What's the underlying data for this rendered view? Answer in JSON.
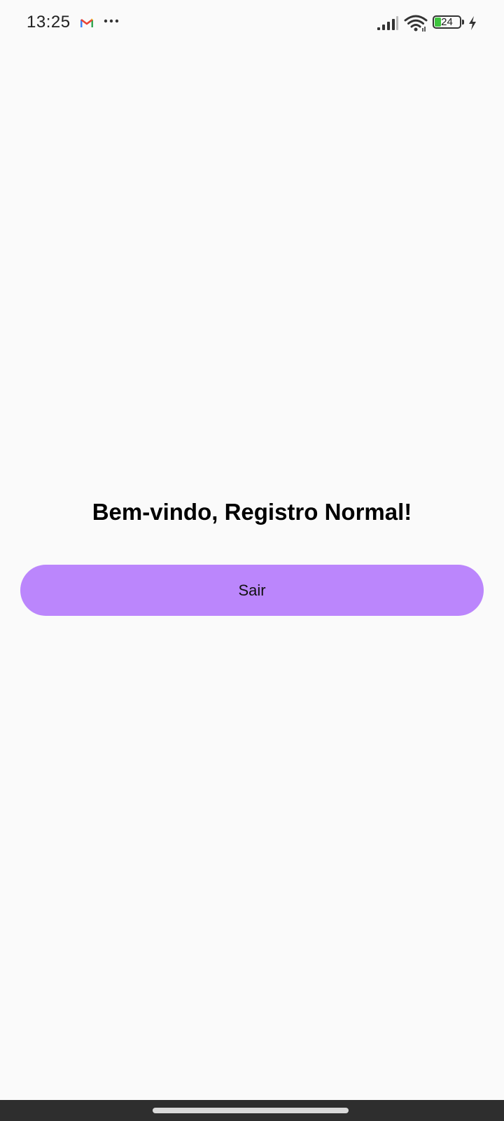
{
  "status_bar": {
    "time": "13:25",
    "battery_level": "24",
    "battery_fraction": 0.24,
    "notification_icons": [
      "gmail-icon",
      "more-icon"
    ],
    "system_icons": [
      "signal-icon",
      "wifi-icon",
      "battery-icon",
      "charging-icon"
    ]
  },
  "main": {
    "welcome_text": "Bem-vindo, Registro Normal!",
    "logout_label": "Sair"
  },
  "colors": {
    "background": "#fafafa",
    "button": "#bb86fc",
    "nav_bar": "#2e2e2e",
    "battery_fill": "#3ec43e"
  }
}
